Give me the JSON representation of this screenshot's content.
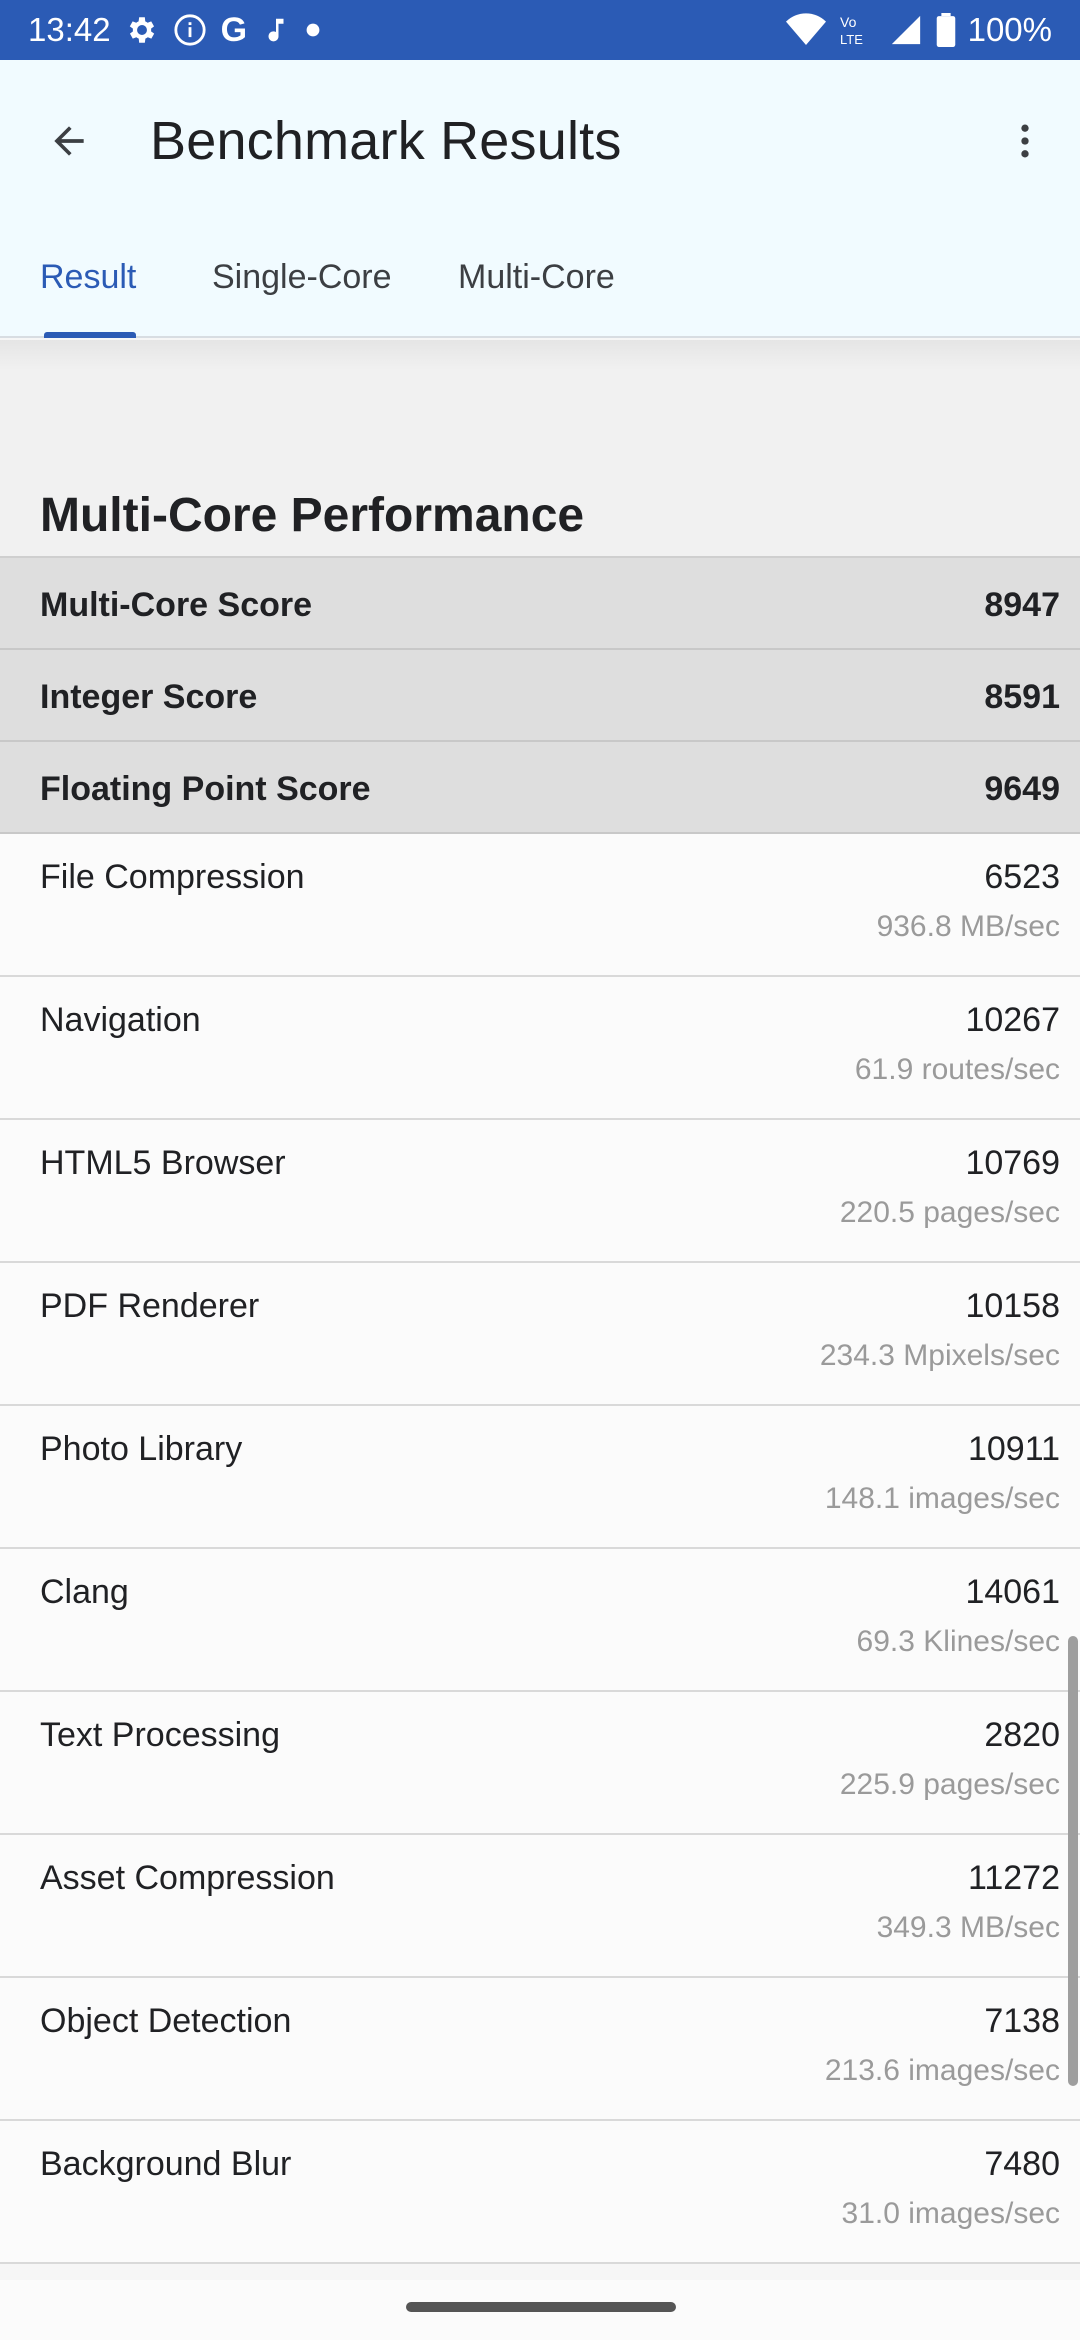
{
  "status_bar": {
    "time": "13:42",
    "battery": "100%",
    "icons_left": [
      "settings-icon",
      "info-icon",
      "google-icon",
      "music-note-icon",
      "dot-icon"
    ],
    "icons_right": [
      "wifi-icon",
      "volte-icon",
      "signal-icon",
      "battery-icon"
    ]
  },
  "app_bar": {
    "title": "Benchmark Results",
    "back_icon": "arrow-back-icon",
    "more_icon": "more-vert-icon"
  },
  "tabs": [
    {
      "label": "Result",
      "active": true
    },
    {
      "label": "Single-Core",
      "active": false
    },
    {
      "label": "Multi-Core",
      "active": false
    }
  ],
  "section_title": "Multi-Core Performance",
  "summary_scores": [
    {
      "label": "Multi-Core Score",
      "value": "8947"
    },
    {
      "label": "Integer Score",
      "value": "8591"
    },
    {
      "label": "Floating Point Score",
      "value": "9649"
    }
  ],
  "tests": [
    {
      "label": "File Compression",
      "score": "6523",
      "rate": "936.8 MB/sec"
    },
    {
      "label": "Navigation",
      "score": "10267",
      "rate": "61.9 routes/sec"
    },
    {
      "label": "HTML5 Browser",
      "score": "10769",
      "rate": "220.5 pages/sec"
    },
    {
      "label": "PDF Renderer",
      "score": "10158",
      "rate": "234.3 Mpixels/sec"
    },
    {
      "label": "Photo Library",
      "score": "10911",
      "rate": "148.1 images/sec"
    },
    {
      "label": "Clang",
      "score": "14061",
      "rate": "69.3 Klines/sec"
    },
    {
      "label": "Text Processing",
      "score": "2820",
      "rate": "225.9 pages/sec"
    },
    {
      "label": "Asset Compression",
      "score": "11272",
      "rate": "349.3 MB/sec"
    },
    {
      "label": "Object Detection",
      "score": "7138",
      "rate": "213.6 images/sec"
    },
    {
      "label": "Background Blur",
      "score": "7480",
      "rate": "31.0 images/sec"
    }
  ],
  "colors": {
    "status_bar": "#2b5bb5",
    "accent": "#2b5bb5",
    "app_bar_bg": "#f1fbff"
  }
}
